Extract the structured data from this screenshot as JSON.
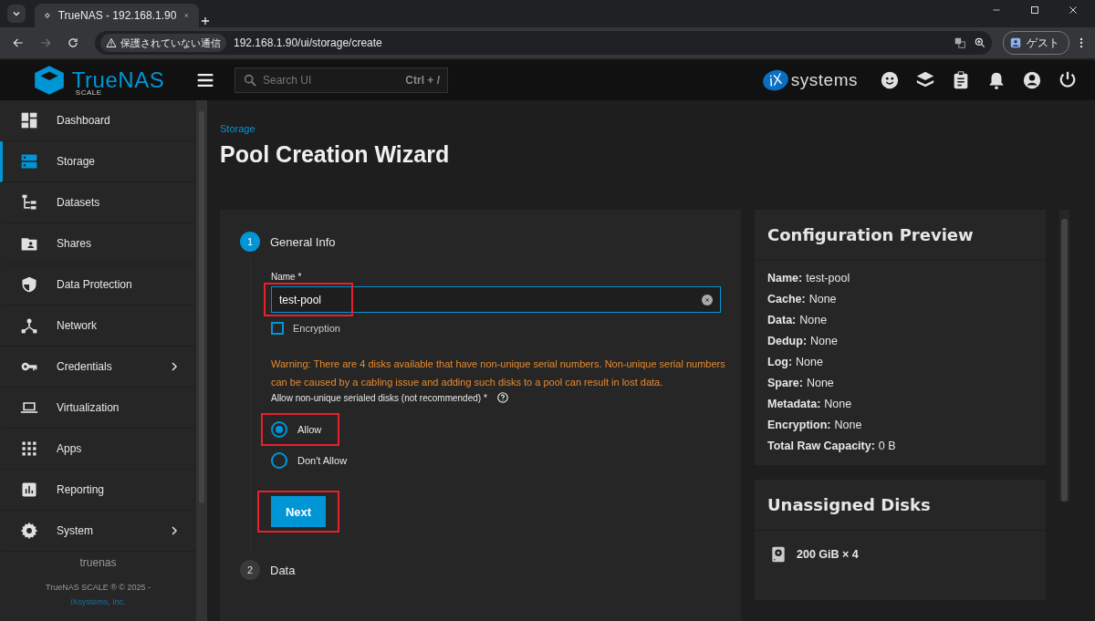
{
  "browser": {
    "tab_title": "TrueNAS - 192.168.1.90",
    "security_label": "保護されていない通信",
    "url": "192.168.1.90/ui/storage/create",
    "profile_label": "ゲスト"
  },
  "header": {
    "logo_text": "TrueNAS",
    "logo_sub": "SCALE",
    "vendor_mark": "iX",
    "vendor_text": "systems",
    "search_placeholder": "Search UI",
    "search_shortcut": "Ctrl + /"
  },
  "sidebar": {
    "items": [
      {
        "label": "Dashboard",
        "selected": false,
        "expandable": false
      },
      {
        "label": "Storage",
        "selected": true,
        "expandable": false
      },
      {
        "label": "Datasets",
        "selected": false,
        "expandable": false
      },
      {
        "label": "Shares",
        "selected": false,
        "expandable": false
      },
      {
        "label": "Data Protection",
        "selected": false,
        "expandable": false
      },
      {
        "label": "Network",
        "selected": false,
        "expandable": false
      },
      {
        "label": "Credentials",
        "selected": false,
        "expandable": true
      },
      {
        "label": "Virtualization",
        "selected": false,
        "expandable": false
      },
      {
        "label": "Apps",
        "selected": false,
        "expandable": false
      },
      {
        "label": "Reporting",
        "selected": false,
        "expandable": false
      },
      {
        "label": "System",
        "selected": false,
        "expandable": true
      }
    ],
    "hostname": "truenas",
    "copyright": "TrueNAS SCALE ® © 2025 -",
    "company_link": "iXsystems, Inc."
  },
  "page": {
    "breadcrumb": "Storage",
    "title": "Pool Creation Wizard"
  },
  "wizard": {
    "steps": [
      {
        "number": "1",
        "title": "General Info",
        "active": true
      },
      {
        "number": "2",
        "title": "Data",
        "active": false
      }
    ],
    "name_label": "Name *",
    "name_value": "test-pool",
    "name_highlighted": true,
    "encryption": {
      "label": "Encryption",
      "checked": false
    },
    "warning": "Warning: There are 4 disks available that have non-unique serial numbers. Non-unique serial numbers can be caused by a cabling issue and adding such disks to a pool can result in lost data.",
    "radio_label": "Allow non-unique serialed disks (not recommended) *",
    "options": [
      {
        "label": "Allow",
        "selected": true,
        "highlighted": true
      },
      {
        "label": "Don't Allow",
        "selected": false,
        "highlighted": false
      }
    ],
    "next_button": {
      "label": "Next",
      "highlighted": true
    }
  },
  "preview": {
    "title": "Configuration Preview",
    "rows": [
      {
        "label": "Name:",
        "value": "test-pool"
      },
      {
        "label": "Cache:",
        "value": "None"
      },
      {
        "label": "Data:",
        "value": "None"
      },
      {
        "label": "Dedup:",
        "value": "None"
      },
      {
        "label": "Log:",
        "value": "None"
      },
      {
        "label": "Spare:",
        "value": "None"
      },
      {
        "label": "Metadata:",
        "value": "None"
      },
      {
        "label": "Encryption:",
        "value": "None"
      },
      {
        "label": "Total Raw Capacity:",
        "value": "0 B"
      }
    ]
  },
  "unassigned": {
    "title": "Unassigned Disks",
    "disks": [
      {
        "label": "200 GiB × 4"
      }
    ]
  }
}
